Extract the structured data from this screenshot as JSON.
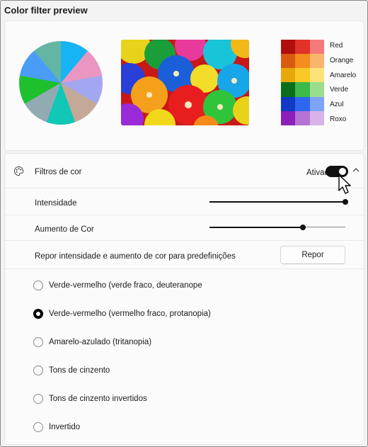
{
  "preview": {
    "title": "Color filter preview",
    "pie_colors": [
      "#16b4f4",
      "#e996c2",
      "#a3a6f1",
      "#c4a898",
      "#11c7b5",
      "#92aab2",
      "#1ec12d",
      "#4a9df7",
      "#63b6a3"
    ],
    "photo_description": "",
    "swatches": [
      {
        "label": "Red",
        "colors": [
          "#b00e0e",
          "#e2332b",
          "#f47979"
        ]
      },
      {
        "label": "Orange",
        "colors": [
          "#d85c10",
          "#f48c1e",
          "#f9b66b"
        ]
      },
      {
        "label": "Amarelo",
        "colors": [
          "#e8a80a",
          "#f9ca27",
          "#fbe37a"
        ]
      },
      {
        "label": "Verde",
        "colors": [
          "#0b6e1b",
          "#3cb94a",
          "#9ade8d"
        ]
      },
      {
        "label": "Azul",
        "colors": [
          "#1039c4",
          "#2f66f0",
          "#7ea4f8"
        ]
      },
      {
        "label": "Roxo",
        "colors": [
          "#8c1fb8",
          "#b673d6",
          "#d8b3ea"
        ]
      }
    ]
  },
  "filters": {
    "label": "Filtros de cor",
    "toggle_label": "Ativado",
    "toggle_on": true,
    "intensity_label": "Intensidade",
    "intensity_value": 1.0,
    "boost_label": "Aumento de Cor",
    "boost_value": 0.69,
    "reset_text": "Repor intensidade e aumento de cor para predefinições",
    "reset_button": "Repor",
    "options": [
      {
        "label": "Verde-vermelho (verde fraco, deuteranope",
        "selected": false
      },
      {
        "label": "Verde-vermelho (vermelho fraco, protanopia)",
        "selected": true
      },
      {
        "label": "Amarelo-azulado (tritanopia)",
        "selected": false
      },
      {
        "label": "Tons de cinzento",
        "selected": false
      },
      {
        "label": "Tons de cinzento invertidos",
        "selected": false
      },
      {
        "label": "Invertido",
        "selected": false
      }
    ]
  },
  "icons": {
    "palette": "palette-icon",
    "chevron": "chevron-up-icon",
    "cursor": "mouse-pointer-icon"
  }
}
